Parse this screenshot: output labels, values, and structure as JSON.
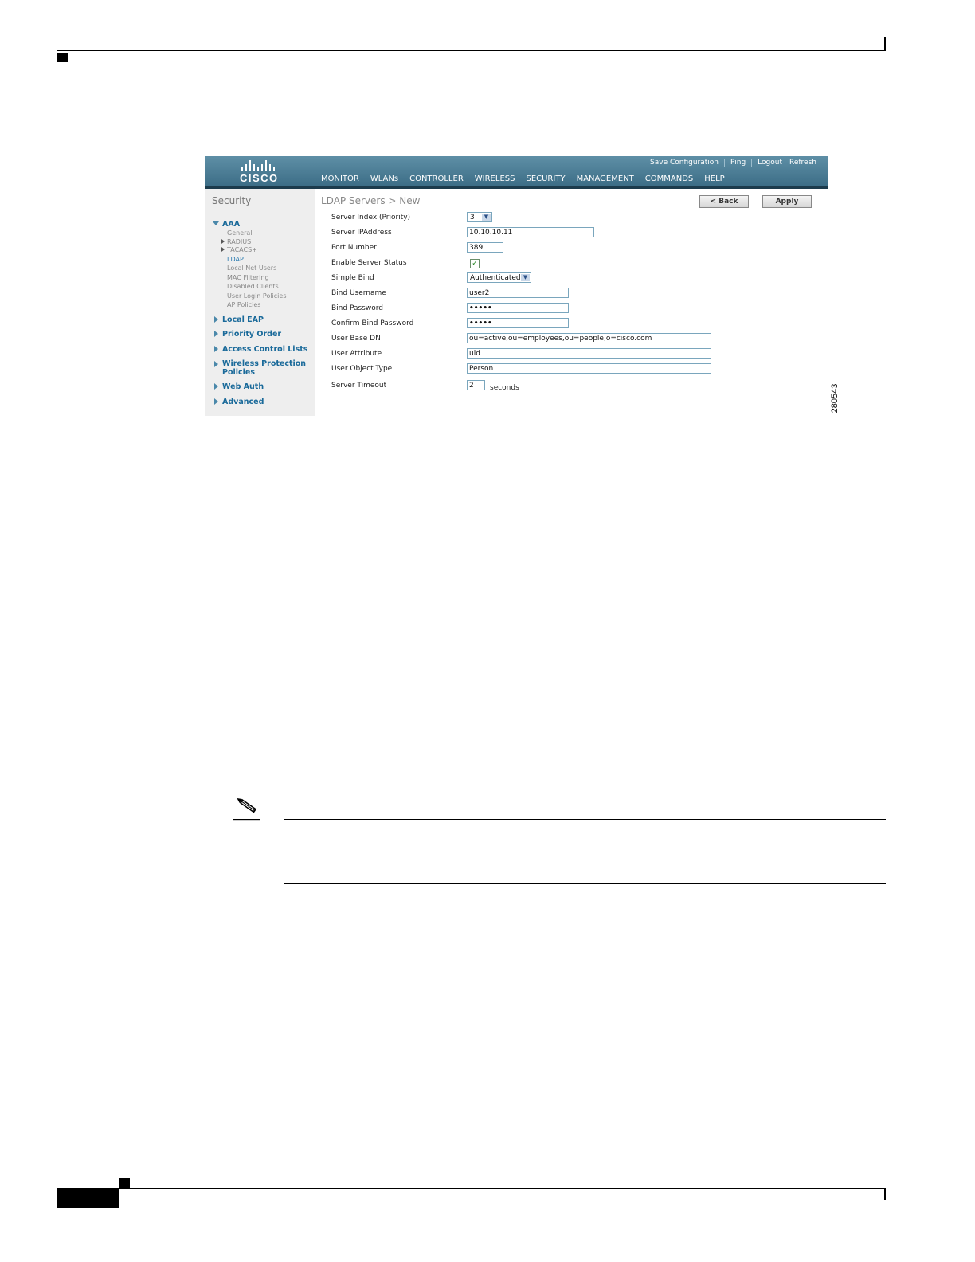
{
  "figure_id": "280543",
  "app": {
    "logo_text": "CISCO",
    "top_links": [
      "Save Configuration",
      "Ping",
      "Logout",
      "Refresh"
    ],
    "nav": [
      "MONITOR",
      "WLANs",
      "CONTROLLER",
      "WIRELESS",
      "SECURITY",
      "MANAGEMENT",
      "COMMANDS",
      "HELP"
    ],
    "active_nav": "SECURITY"
  },
  "sidebar": {
    "title": "Security",
    "aaa_label": "AAA",
    "aaa_items": [
      "General",
      "RADIUS",
      "TACACS+",
      "LDAP",
      "Local Net Users",
      "MAC Filtering",
      "Disabled Clients",
      "User Login Policies",
      "AP Policies"
    ],
    "sections": [
      "Local EAP",
      "Priority Order",
      "Access Control Lists",
      "Wireless Protection Policies",
      "Web Auth",
      "Advanced"
    ]
  },
  "page": {
    "title": "LDAP Servers > New",
    "back_label": "< Back",
    "apply_label": "Apply"
  },
  "form": {
    "server_index_label": "Server Index (Priority)",
    "server_index_value": "3",
    "server_ip_label": "Server IPAddress",
    "server_ip_value": "10.10.10.11",
    "port_label": "Port Number",
    "port_value": "389",
    "enable_label": "Enable Server Status",
    "enable_checked": true,
    "simple_bind_label": "Simple Bind",
    "simple_bind_value": "Authenticated",
    "bind_username_label": "Bind Username",
    "bind_username_value": "user2",
    "bind_password_label": "Bind Password",
    "bind_password_value": "•••••",
    "confirm_password_label": "Confirm Bind Password",
    "confirm_password_value": "•••••",
    "base_dn_label": "User Base DN",
    "base_dn_value": "ou=active,ou=employees,ou=people,o=cisco.com",
    "user_attr_label": "User Attribute",
    "user_attr_value": "uid",
    "object_type_label": "User Object Type",
    "object_type_value": "Person",
    "timeout_label": "Server Timeout",
    "timeout_value": "2",
    "timeout_unit": "seconds"
  }
}
